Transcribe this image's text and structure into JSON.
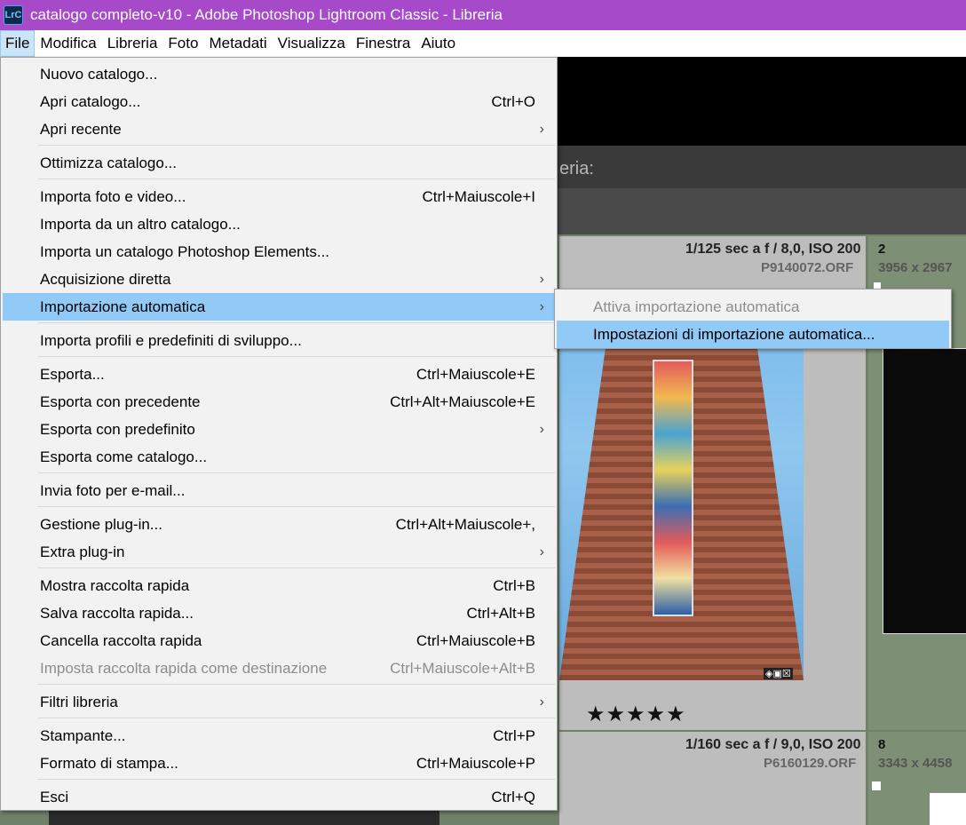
{
  "window": {
    "logo_text": "LrC",
    "title": "catalogo completo-v10 - Adobe Photoshop Lightroom Classic - Libreria"
  },
  "menubar": [
    "File",
    "Modifica",
    "Libreria",
    "Foto",
    "Metadati",
    "Visualizza",
    "Finestra",
    "Aiuto"
  ],
  "file_menu": {
    "items": [
      {
        "label": "Nuovo catalogo...",
        "shortcut": ""
      },
      {
        "label": "Apri catalogo...",
        "shortcut": "Ctrl+O"
      },
      {
        "label": "Apri recente",
        "shortcut": ""
      },
      {
        "label": "Ottimizza catalogo...",
        "shortcut": ""
      },
      {
        "label": "Importa foto e video...",
        "shortcut": "Ctrl+Maiuscole+I"
      },
      {
        "label": "Importa da un altro catalogo...",
        "shortcut": ""
      },
      {
        "label": "Importa un catalogo Photoshop Elements...",
        "shortcut": ""
      },
      {
        "label": "Acquisizione diretta",
        "shortcut": ""
      },
      {
        "label": "Importazione automatica",
        "shortcut": ""
      },
      {
        "label": "Importa profili e predefiniti di sviluppo...",
        "shortcut": ""
      },
      {
        "label": "Esporta...",
        "shortcut": "Ctrl+Maiuscole+E"
      },
      {
        "label": "Esporta con precedente",
        "shortcut": "Ctrl+Alt+Maiuscole+E"
      },
      {
        "label": "Esporta con predefinito",
        "shortcut": ""
      },
      {
        "label": "Esporta come catalogo...",
        "shortcut": ""
      },
      {
        "label": "Invia foto per e-mail...",
        "shortcut": ""
      },
      {
        "label": "Gestione plug-in...",
        "shortcut": "Ctrl+Alt+Maiuscole+,"
      },
      {
        "label": "Extra plug-in",
        "shortcut": ""
      },
      {
        "label": "Mostra raccolta rapida",
        "shortcut": "Ctrl+B"
      },
      {
        "label": "Salva raccolta rapida...",
        "shortcut": "Ctrl+Alt+B"
      },
      {
        "label": "Cancella raccolta rapida",
        "shortcut": "Ctrl+Maiuscole+B"
      },
      {
        "label": "Imposta raccolta rapida come destinazione",
        "shortcut": "Ctrl+Maiuscole+Alt+B"
      },
      {
        "label": "Filtri libreria",
        "shortcut": ""
      },
      {
        "label": "Stampante...",
        "shortcut": "Ctrl+P"
      },
      {
        "label": "Formato di stampa...",
        "shortcut": "Ctrl+Maiuscole+P"
      },
      {
        "label": "Esci",
        "shortcut": "Ctrl+Q"
      }
    ]
  },
  "submenu": {
    "items": [
      {
        "label": "Attiva importazione automatica"
      },
      {
        "label": "Impostazioni di importazione automatica..."
      }
    ]
  },
  "background": {
    "filter_label": "eria:",
    "cell1": {
      "exif": "1/125 sec a f / 8,0, ISO 200",
      "file": "P9140072.ORF",
      "rating": "★★★★★"
    },
    "cell2": {
      "index": "2",
      "dims": "3956 x 2967"
    },
    "cell3": {
      "exif": "1/160 sec a f / 9,0, ISO 200",
      "file": "P6160129.ORF"
    },
    "cell4": {
      "index": "8",
      "dims": "3343 x 4458"
    }
  }
}
